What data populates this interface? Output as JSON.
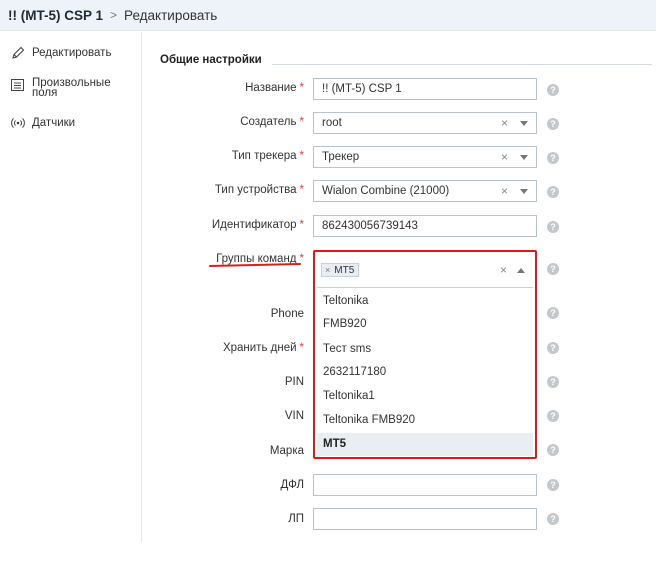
{
  "breadcrumb": {
    "root": "!! (MT-5) CSP 1",
    "separator": ">",
    "current": "Редактировать"
  },
  "sidebar": {
    "items": [
      {
        "label": "Редактировать",
        "icon": "pencil-icon"
      },
      {
        "label": "Произвольные поля",
        "icon": "list-icon"
      },
      {
        "label": "Датчики",
        "icon": "sensor-icon"
      }
    ]
  },
  "section": {
    "title": "Общие настройки"
  },
  "form": {
    "required_mark": "*",
    "help_glyph": "?",
    "clear_glyph": "×",
    "name": {
      "label": "Название",
      "value": "!! (MT-5) CSP 1"
    },
    "creator": {
      "label": "Создатель",
      "value": "root"
    },
    "tracker_type": {
      "label": "Тип трекера",
      "value": "Трекер"
    },
    "device_type": {
      "label": "Тип устройства",
      "value": "Wialon Combine (21000)"
    },
    "identifier": {
      "label": "Идентификатор",
      "value": "862430056739143"
    },
    "command_groups": {
      "label": "Группы команд",
      "selected": "MT5",
      "options": [
        "Teltonika",
        "FMB920",
        "Тест sms",
        "2632117180",
        "Teltonika1",
        "Teltonika FMB920",
        "MT5"
      ],
      "highlighted": "MT5"
    },
    "phone": {
      "label": "Phone"
    },
    "keep_days": {
      "label": "Хранить дней"
    },
    "pin": {
      "label": "PIN"
    },
    "vin": {
      "label": "VIN"
    },
    "brand": {
      "label": "Марка"
    },
    "dfl": {
      "label": "ДФЛ",
      "value": ""
    },
    "lp": {
      "label": "ЛП",
      "value": ""
    }
  },
  "colors": {
    "accent_red": "#e01818",
    "header_bg": "#eef3f9"
  }
}
